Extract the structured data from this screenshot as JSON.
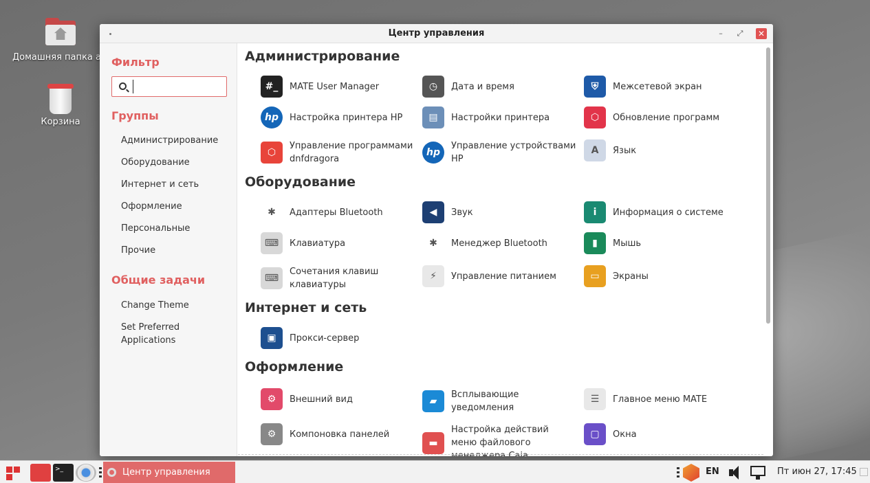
{
  "desktop": {
    "home_label": "Домашняя папка ale",
    "trash_label": "Корзина"
  },
  "window": {
    "title": "Центр управления",
    "minimize": "–",
    "maximize": "⤢",
    "close": "✕"
  },
  "sidebar": {
    "filter_heading": "Фильтр",
    "search_value": "",
    "groups_heading": "Группы",
    "groups": [
      "Администрирование",
      "Оборудование",
      "Интернет и сеть",
      "Оформление",
      "Персональные",
      "Прочие"
    ],
    "tasks_heading": "Общие задачи",
    "tasks": [
      "Change Theme",
      "Set Preferred Applications"
    ]
  },
  "sections": [
    {
      "title": "Администрирование",
      "items": [
        {
          "label": "MATE User Manager",
          "icon": "terminal-icon",
          "color": "#222222"
        },
        {
          "label": "Дата и время",
          "icon": "clock-icon",
          "color": "#555555"
        },
        {
          "label": "Межсетевой экран",
          "icon": "shield-icon",
          "color": "#1e5aa8"
        },
        {
          "label": "Настройка принтера HP",
          "icon": "hp-icon",
          "color": "#1466b8"
        },
        {
          "label": "Настройки принтера",
          "icon": "printer-icon",
          "color": "#6c8fb8"
        },
        {
          "label": "Обновление программ",
          "icon": "package-icon",
          "color": "#e2344a"
        },
        {
          "label": "Управление программами dnfdragora",
          "icon": "package-icon",
          "color": "#e8443a"
        },
        {
          "label": "Управление устройствами HP",
          "icon": "hp-icon",
          "color": "#1466b8"
        },
        {
          "label": "Язык",
          "icon": "language-icon",
          "color": "#cfd8e6"
        }
      ]
    },
    {
      "title": "Оборудование",
      "items": [
        {
          "label": "Адаптеры Bluetooth",
          "icon": "bluetooth-icon",
          "color": "#ffffff"
        },
        {
          "label": "Звук",
          "icon": "speaker-icon",
          "color": "#1d3f73"
        },
        {
          "label": "Информация о системе",
          "icon": "info-icon",
          "color": "#1a8a72"
        },
        {
          "label": "Клавиатура",
          "icon": "keyboard-icon",
          "color": "#d8d8d8"
        },
        {
          "label": "Менеджер Bluetooth",
          "icon": "bluetooth-icon",
          "color": "#ffffff"
        },
        {
          "label": "Мышь",
          "icon": "mouse-icon",
          "color": "#1a8a5a"
        },
        {
          "label": "Сочетания клавиш клавиатуры",
          "icon": "keyboard-icon",
          "color": "#d8d8d8"
        },
        {
          "label": "Управление питанием",
          "icon": "power-icon",
          "color": "#e8e8e8"
        },
        {
          "label": "Экраны",
          "icon": "display-icon",
          "color": "#e8a020"
        }
      ]
    },
    {
      "title": "Интернет и сеть",
      "items": [
        {
          "label": "Прокси-сервер",
          "icon": "proxy-icon",
          "color": "#1d4f8f"
        }
      ]
    },
    {
      "title": "Оформление",
      "items": [
        {
          "label": "Внешний вид",
          "icon": "appearance-icon",
          "color": "#e24a6a"
        },
        {
          "label": "Всплывающие уведомления",
          "icon": "notification-icon",
          "color": "#1b8ad6"
        },
        {
          "label": "Главное меню MATE",
          "icon": "menu-list-icon",
          "color": "#e8e8e8"
        },
        {
          "label": "Компоновка панелей",
          "icon": "gear-icon",
          "color": "#888888"
        },
        {
          "label": "Настройка действий меню файлового менеджера Caja",
          "icon": "folder-icon",
          "color": "#e05050"
        },
        {
          "label": "Окна",
          "icon": "window-icon",
          "color": "#6a4fc8"
        }
      ]
    }
  ],
  "taskbar": {
    "task_label": "Центр управления",
    "keyboard_layout": "EN",
    "clock": "Пт июн 27, 17:45"
  }
}
